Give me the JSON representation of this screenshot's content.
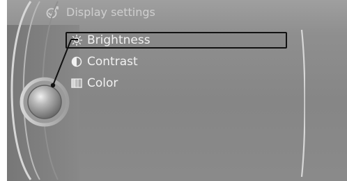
{
  "header": {
    "title": "Display settings",
    "icon": "settings-wrench-icon"
  },
  "menu": {
    "items": [
      {
        "label": "Brightness",
        "icon": "sun-icon",
        "selected": true
      },
      {
        "label": "Contrast",
        "icon": "contrast-icon",
        "selected": false
      },
      {
        "label": "Color",
        "icon": "color-icon",
        "selected": false
      }
    ]
  },
  "colors": {
    "text": "#f1f1f1",
    "title_text": "#cfcfcf",
    "selection_border": "#111111",
    "panel_bg": "#8f8f8f"
  }
}
